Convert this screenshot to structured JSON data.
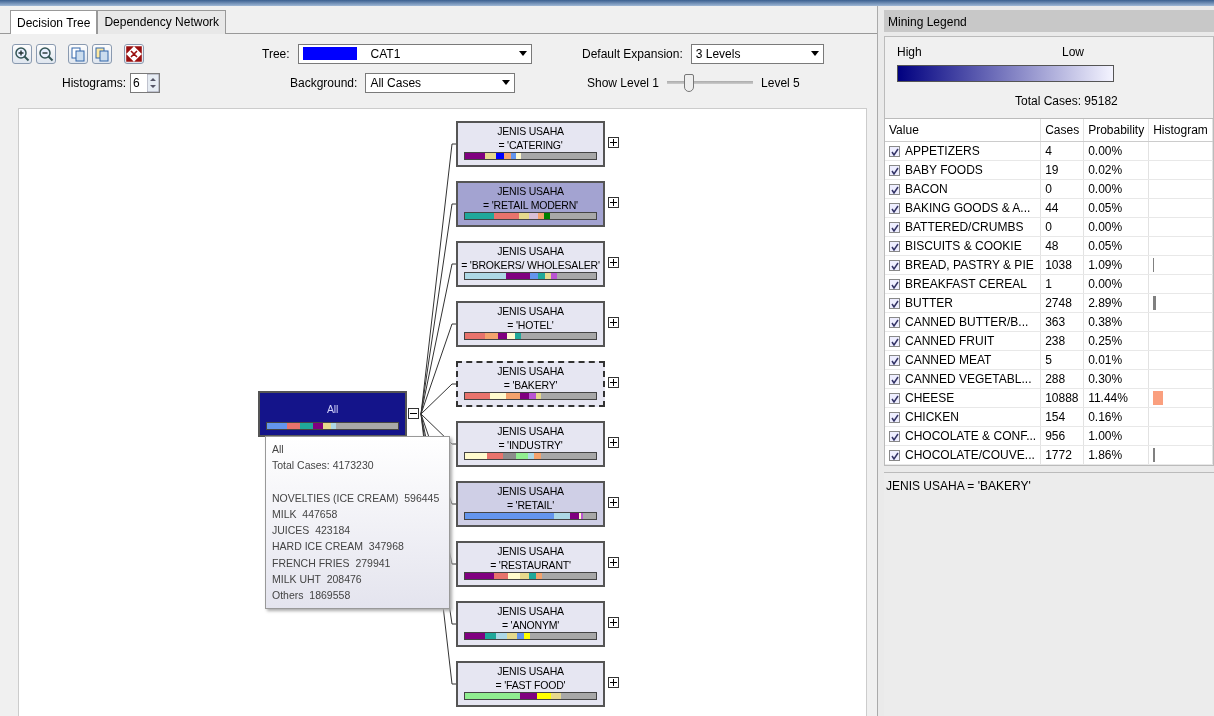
{
  "tabs": [
    {
      "label": "Decision Tree",
      "selected": true
    },
    {
      "label": "Dependency Network",
      "selected": false
    }
  ],
  "toolbar": {
    "tree_label": "Tree:",
    "tree": {
      "value": "CAT1",
      "color": "#0000ff"
    },
    "histograms_label": "Histograms:",
    "histograms": "6",
    "background_label": "Background:",
    "background": "All Cases",
    "expansion_label": "Default Expansion:",
    "expansion": "3 Levels",
    "show_label": "Show Level 1",
    "level_max_label": "Level 5",
    "show_level": {
      "level": 0.25
    }
  },
  "tree": {
    "root": {
      "label": "All",
      "color": "#14148a",
      "expanded": true,
      "segments": [
        {
          "color": "#6495ed"
        },
        {
          "color": "#e8736c"
        },
        {
          "color": "#20a89a"
        },
        {
          "color": "#800080"
        },
        {
          "color": "#e6d98c"
        },
        {
          "color": "#add8e6"
        }
      ]
    },
    "children": [
      {
        "attribute": "JENIS USAHA",
        "condition": "= 'CATERING'",
        "color": "#e6e6f2",
        "focused": false,
        "expanded": false,
        "segments": [
          {
            "color": "#800080"
          },
          {
            "color": "#e6d98c"
          },
          {
            "color": "#0000ff"
          },
          {
            "color": "#f4a26c"
          },
          {
            "color": "#6495ed"
          },
          {
            "color": "#fffacd"
          }
        ]
      },
      {
        "attribute": "JENIS USAHA",
        "condition": "= 'RETAIL MODERN'",
        "color": "#a3a3d1",
        "focused": false,
        "expanded": false,
        "segments": [
          {
            "color": "#20a89a"
          },
          {
            "color": "#e8736c"
          },
          {
            "color": "#e6d98c"
          },
          {
            "color": "#d8bfd8"
          },
          {
            "color": "#f4a26c"
          },
          {
            "color": "#008000"
          }
        ]
      },
      {
        "attribute": "JENIS USAHA",
        "condition": "= 'BROKERS/ WHOLESALER'",
        "color": "#e6e6f2",
        "focused": false,
        "expanded": false,
        "segments": [
          {
            "color": "#add8e6"
          },
          {
            "color": "#800080"
          },
          {
            "color": "#6495ed"
          },
          {
            "color": "#20a89a"
          },
          {
            "color": "#e6d98c"
          },
          {
            "color": "#ba55d3"
          }
        ]
      },
      {
        "attribute": "JENIS USAHA",
        "condition": "= 'HOTEL'",
        "color": "#e6e6f2",
        "focused": false,
        "expanded": false,
        "segments": [
          {
            "color": "#e8736c"
          },
          {
            "color": "#f4a26c"
          },
          {
            "color": "#800080"
          },
          {
            "color": "#fffacd"
          },
          {
            "color": "#20a89a"
          }
        ]
      },
      {
        "attribute": "JENIS USAHA",
        "condition": "= 'BAKERY'",
        "color": "#e6e6f2",
        "focused": true,
        "expanded": false,
        "segments": [
          {
            "color": "#e8736c"
          },
          {
            "color": "#fffacd"
          },
          {
            "color": "#f4a26c"
          },
          {
            "color": "#800080"
          },
          {
            "color": "#ba55d3"
          },
          {
            "color": "#e6d98c"
          }
        ]
      },
      {
        "attribute": "JENIS USAHA",
        "condition": "= 'INDUSTRY'",
        "color": "#e6e6f2",
        "focused": false,
        "expanded": false,
        "segments": [
          {
            "color": "#fffacd"
          },
          {
            "color": "#e8736c"
          },
          {
            "color": "#8c8c8c"
          },
          {
            "color": "#90ee90"
          },
          {
            "color": "#add8e6"
          },
          {
            "color": "#f4a26c"
          }
        ]
      },
      {
        "attribute": "JENIS USAHA",
        "condition": "= 'RETAIL'",
        "color": "#cfcfe6",
        "focused": false,
        "expanded": false,
        "segments": [
          {
            "color": "#6495ed"
          },
          {
            "color": "#add8e6"
          },
          {
            "color": "#800080"
          },
          {
            "color": "#fffacd"
          },
          {
            "color": "#ba55d3"
          }
        ]
      },
      {
        "attribute": "JENIS USAHA",
        "condition": "= 'RESTAURANT'",
        "color": "#e6e6f2",
        "focused": false,
        "expanded": false,
        "segments": [
          {
            "color": "#800080"
          },
          {
            "color": "#e8736c"
          },
          {
            "color": "#fffacd"
          },
          {
            "color": "#e6d98c"
          },
          {
            "color": "#20a89a"
          },
          {
            "color": "#f4a26c"
          }
        ]
      },
      {
        "attribute": "JENIS USAHA",
        "condition": "= 'ANONYM'",
        "color": "#e6e6f2",
        "focused": false,
        "expanded": false,
        "segments": [
          {
            "color": "#800080"
          },
          {
            "color": "#20a89a"
          },
          {
            "color": "#add8e6"
          },
          {
            "color": "#e6d98c"
          },
          {
            "color": "#6495ed"
          },
          {
            "color": "#ffff00"
          }
        ]
      },
      {
        "attribute": "JENIS USAHA",
        "condition": "= 'FAST FOOD'",
        "color": "#e6e6f2",
        "focused": false,
        "expanded": false,
        "segments": [
          {
            "color": "#90ee90"
          },
          {
            "color": "#800080"
          },
          {
            "color": "#ffff00"
          },
          {
            "color": "#e6d98c"
          }
        ]
      }
    ],
    "tooltip": {
      "title": "All",
      "total": "Total Cases: 4173230",
      "items": [
        "NOVELTIES (ICE CREAM)  596445",
        "MILK  447658",
        "JUICES  423184",
        "HARD ICE CREAM  347968",
        "FRENCH FRIES  279941",
        "MILK UHT  208476",
        "Others  1869558"
      ]
    }
  },
  "legend": {
    "title": "Mining Legend",
    "high": "High",
    "low": "Low",
    "total": "Total Cases: 95182",
    "columns": [
      "Value",
      "Cases",
      "Probability",
      "Histogram"
    ],
    "rows": [
      {
        "value": "APPETIZERS",
        "cases": "4",
        "probability": "0.00%",
        "checked": true
      },
      {
        "value": "BABY FOODS",
        "cases": "19",
        "probability": "0.02%",
        "checked": true
      },
      {
        "value": "BACON",
        "cases": "0",
        "probability": "0.00%",
        "checked": true
      },
      {
        "value": "BAKING GOODS & A...",
        "cases": "44",
        "probability": "0.05%",
        "checked": true
      },
      {
        "value": "BATTERED/CRUMBS",
        "cases": "0",
        "probability": "0.00%",
        "checked": true
      },
      {
        "value": "BISCUITS & COOKIE",
        "cases": "48",
        "probability": "0.05%",
        "checked": true
      },
      {
        "value": "BREAD, PASTRY & PIE",
        "cases": "1038",
        "probability": "1.09%",
        "checked": true,
        "color": "#808080",
        "level": 0.01
      },
      {
        "value": "BREAKFAST CEREAL",
        "cases": "1",
        "probability": "0.00%",
        "checked": true
      },
      {
        "value": "BUTTER",
        "cases": "2748",
        "probability": "2.89%",
        "checked": true,
        "color": "#808080",
        "level": 0.03
      },
      {
        "value": "CANNED BUTTER/B...",
        "cases": "363",
        "probability": "0.38%",
        "checked": true
      },
      {
        "value": "CANNED FRUIT",
        "cases": "238",
        "probability": "0.25%",
        "checked": true
      },
      {
        "value": "CANNED MEAT",
        "cases": "5",
        "probability": "0.01%",
        "checked": true
      },
      {
        "value": "CANNED VEGETABL...",
        "cases": "288",
        "probability": "0.30%",
        "checked": true
      },
      {
        "value": "CHEESE",
        "cases": "10888",
        "probability": "11.44%",
        "checked": true,
        "color": "#fa9f7e",
        "level": 0.114
      },
      {
        "value": "CHICKEN",
        "cases": "154",
        "probability": "0.16%",
        "checked": true
      },
      {
        "value": "CHOCOLATE & CONF...",
        "cases": "956",
        "probability": "1.00%",
        "checked": true
      },
      {
        "value": "CHOCOLATE/COUVE...",
        "cases": "1772",
        "probability": "1.86%",
        "checked": true,
        "color": "#808080",
        "level": 0.019
      }
    ],
    "status": "JENIS USAHA = 'BAKERY'"
  }
}
